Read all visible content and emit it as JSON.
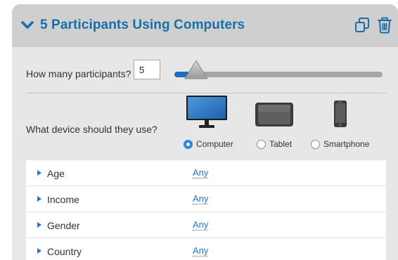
{
  "header": {
    "title": "5 Participants Using Computers",
    "accent_color": "#176fa8",
    "icons": [
      "chevron-down-icon",
      "copy-icon",
      "trash-icon"
    ]
  },
  "participants": {
    "label": "How many participants?",
    "value": "5",
    "slider_fraction": 0.05
  },
  "device": {
    "label": "What device should they use?",
    "options": [
      {
        "label": "Computer",
        "selected": true,
        "icon": "desktop-monitor-icon"
      },
      {
        "label": "Tablet",
        "selected": false,
        "icon": "tablet-icon"
      },
      {
        "label": "Smartphone",
        "selected": false,
        "icon": "smartphone-icon"
      }
    ]
  },
  "criteria": [
    {
      "name": "Age",
      "value": "Any"
    },
    {
      "name": "Income",
      "value": "Any"
    },
    {
      "name": "Gender",
      "value": "Any"
    },
    {
      "name": "Country",
      "value": "Any"
    }
  ]
}
